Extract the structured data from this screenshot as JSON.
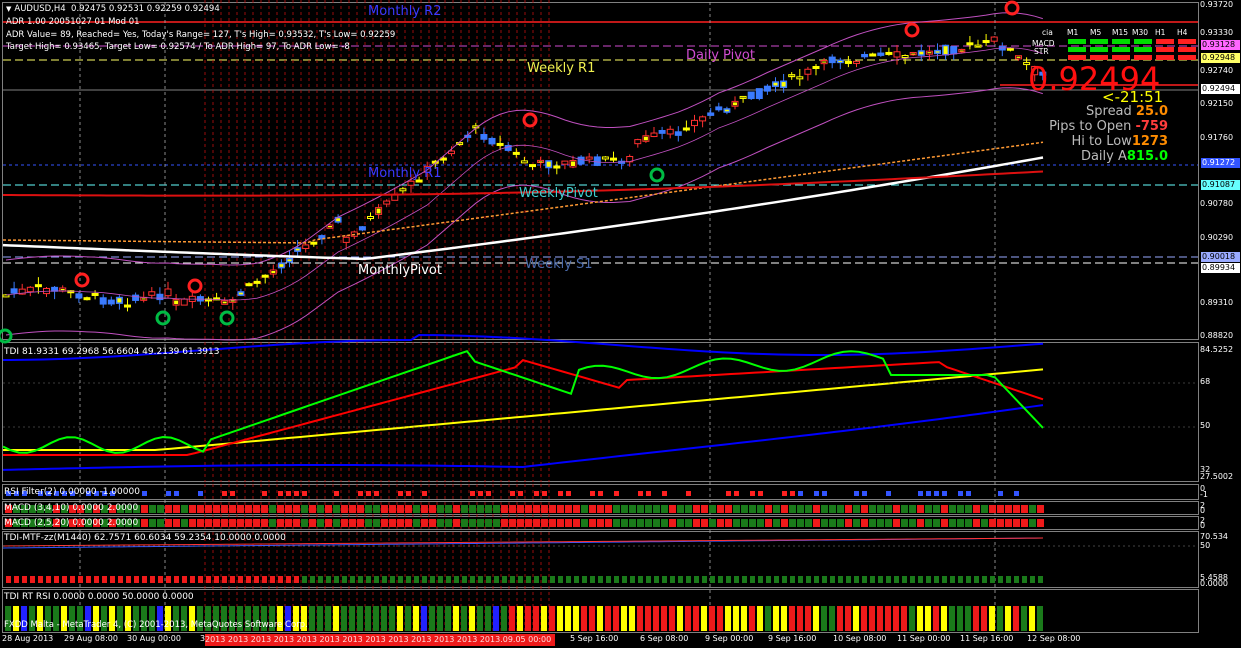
{
  "symbol_line": "AUDUSD,H4  0.92475 0.92531 0.92259 0.92494",
  "info_lines": [
    "ADR 1.00 20051027 01 Mod 01",
    "ADR Value= 89, Reached= Yes, Today's Range= 127, T's High= 0.93532, T's Low= 0.92259",
    "Target High= 0.93465, Target Low= 0.92574 / To ADR High= 97, To ADR Low= -8"
  ],
  "levels": {
    "monthly_r2": "Monthly R2",
    "daily_pivot": "Daily Pivot",
    "weekly_r1": "Weekly R1",
    "monthly_r1": "Monthly R1",
    "weekly_pivot": "WeeklyPivot",
    "monthly_pivot": "MonthlyPivot",
    "weekly_s1": "Weekly S1"
  },
  "big_price": "0.92494",
  "countdown": "<-21:51",
  "stats": [
    {
      "label": "Spread ",
      "value": "25.0",
      "color": "#ff8c00"
    },
    {
      "label": "Pips to Open ",
      "value": "-759",
      "color": "#ff3c3c"
    },
    {
      "label": "Hi to Low",
      "value": "1273",
      "color": "#ff8c00"
    },
    {
      "label": "Daily A",
      "value": "815.0",
      "color": "#00ff00"
    }
  ],
  "signal_panel": {
    "corner_label": "cia",
    "headers": [
      "M1",
      "M5",
      "M15",
      "M30",
      "H1",
      "H4"
    ],
    "rows": [
      "MACD",
      "STR",
      ""
    ]
  },
  "price_axis": {
    "ticks": [
      "0.93720",
      "0.93330",
      "0.92740",
      "0.92494",
      "0.92150",
      "0.91760",
      "0.91370",
      "0.90780",
      "0.90290",
      "0.89890",
      "0.89310",
      "0.88820"
    ],
    "tags": [
      {
        "value": "0.93128",
        "color": "#ff66ff"
      },
      {
        "value": "0.92948",
        "color": "#ffff66"
      },
      {
        "value": "0.92494",
        "color": "#ffffff"
      },
      {
        "value": "0.91272",
        "color": "#3355ff"
      },
      {
        "value": "0.91087",
        "color": "#66ffff"
      },
      {
        "value": "0.90018",
        "color": "#99aaff"
      },
      {
        "value": "0.89934",
        "color": "#ffffff"
      }
    ]
  },
  "tdi_pane": {
    "label": "TDI 81.9331 69.2968 56.6604 49.2139 61.3913",
    "ticks": [
      "84.5252",
      "68",
      "50",
      "32",
      "27.5002"
    ]
  },
  "rsi_filter": {
    "label": "RSI Filter(2) 0.00000 -1.00000",
    "ticks": [
      "0",
      "-1"
    ]
  },
  "macd1": {
    "label": "MACD (3,4,10) 0.0000 2.0000",
    "ticks": [
      "2",
      "0"
    ]
  },
  "macd2": {
    "label": "MACD (2,5,20) 0.0000 2.0000",
    "ticks": [
      "2",
      "0"
    ]
  },
  "tdi_mtf": {
    "label": "TDI-MTF-zz(M1440) 62.7571 60.6034 59.2354 10.0000 0.0000",
    "ticks": [
      "70.534",
      "50",
      "5.4588",
      "0.0000"
    ]
  },
  "tdi_rt": {
    "label": "TDI RT RSI 0.0000 0.0000 50.0000 0.0000"
  },
  "copyright": "FXDD Malta - MetaTrader 4, (C) 2001-2013, MetaQuotes Software Corp.",
  "time_axis": [
    "28 Aug 2013",
    "29 Aug 08:00",
    "30 Aug 00:00",
    "30 Aug 16:00",
    "2 Sep 08:00",
    "3 Sep 00:00",
    "3 Sep 16:00",
    "4 Sep 08:00",
    "5 Sep 00:00",
    "5 Sep 16:00",
    "6 Sep 08:00",
    "9 Sep 00:00",
    "9 Sep 16:00",
    "10 Sep 08:00",
    "11 Sep 00:00",
    "11 Sep 16:00",
    "12 Sep 08:00"
  ],
  "time_tag_text": "2013.09.05 00:00",
  "colors": {
    "bull": "#3a7bff",
    "bear": "#ff3030",
    "doji": "#ffff00",
    "tdi_green": "#00ff00",
    "tdi_red": "#ff0000",
    "tdi_yellow": "#ffff00",
    "tdi_blue": "#0000ff"
  }
}
